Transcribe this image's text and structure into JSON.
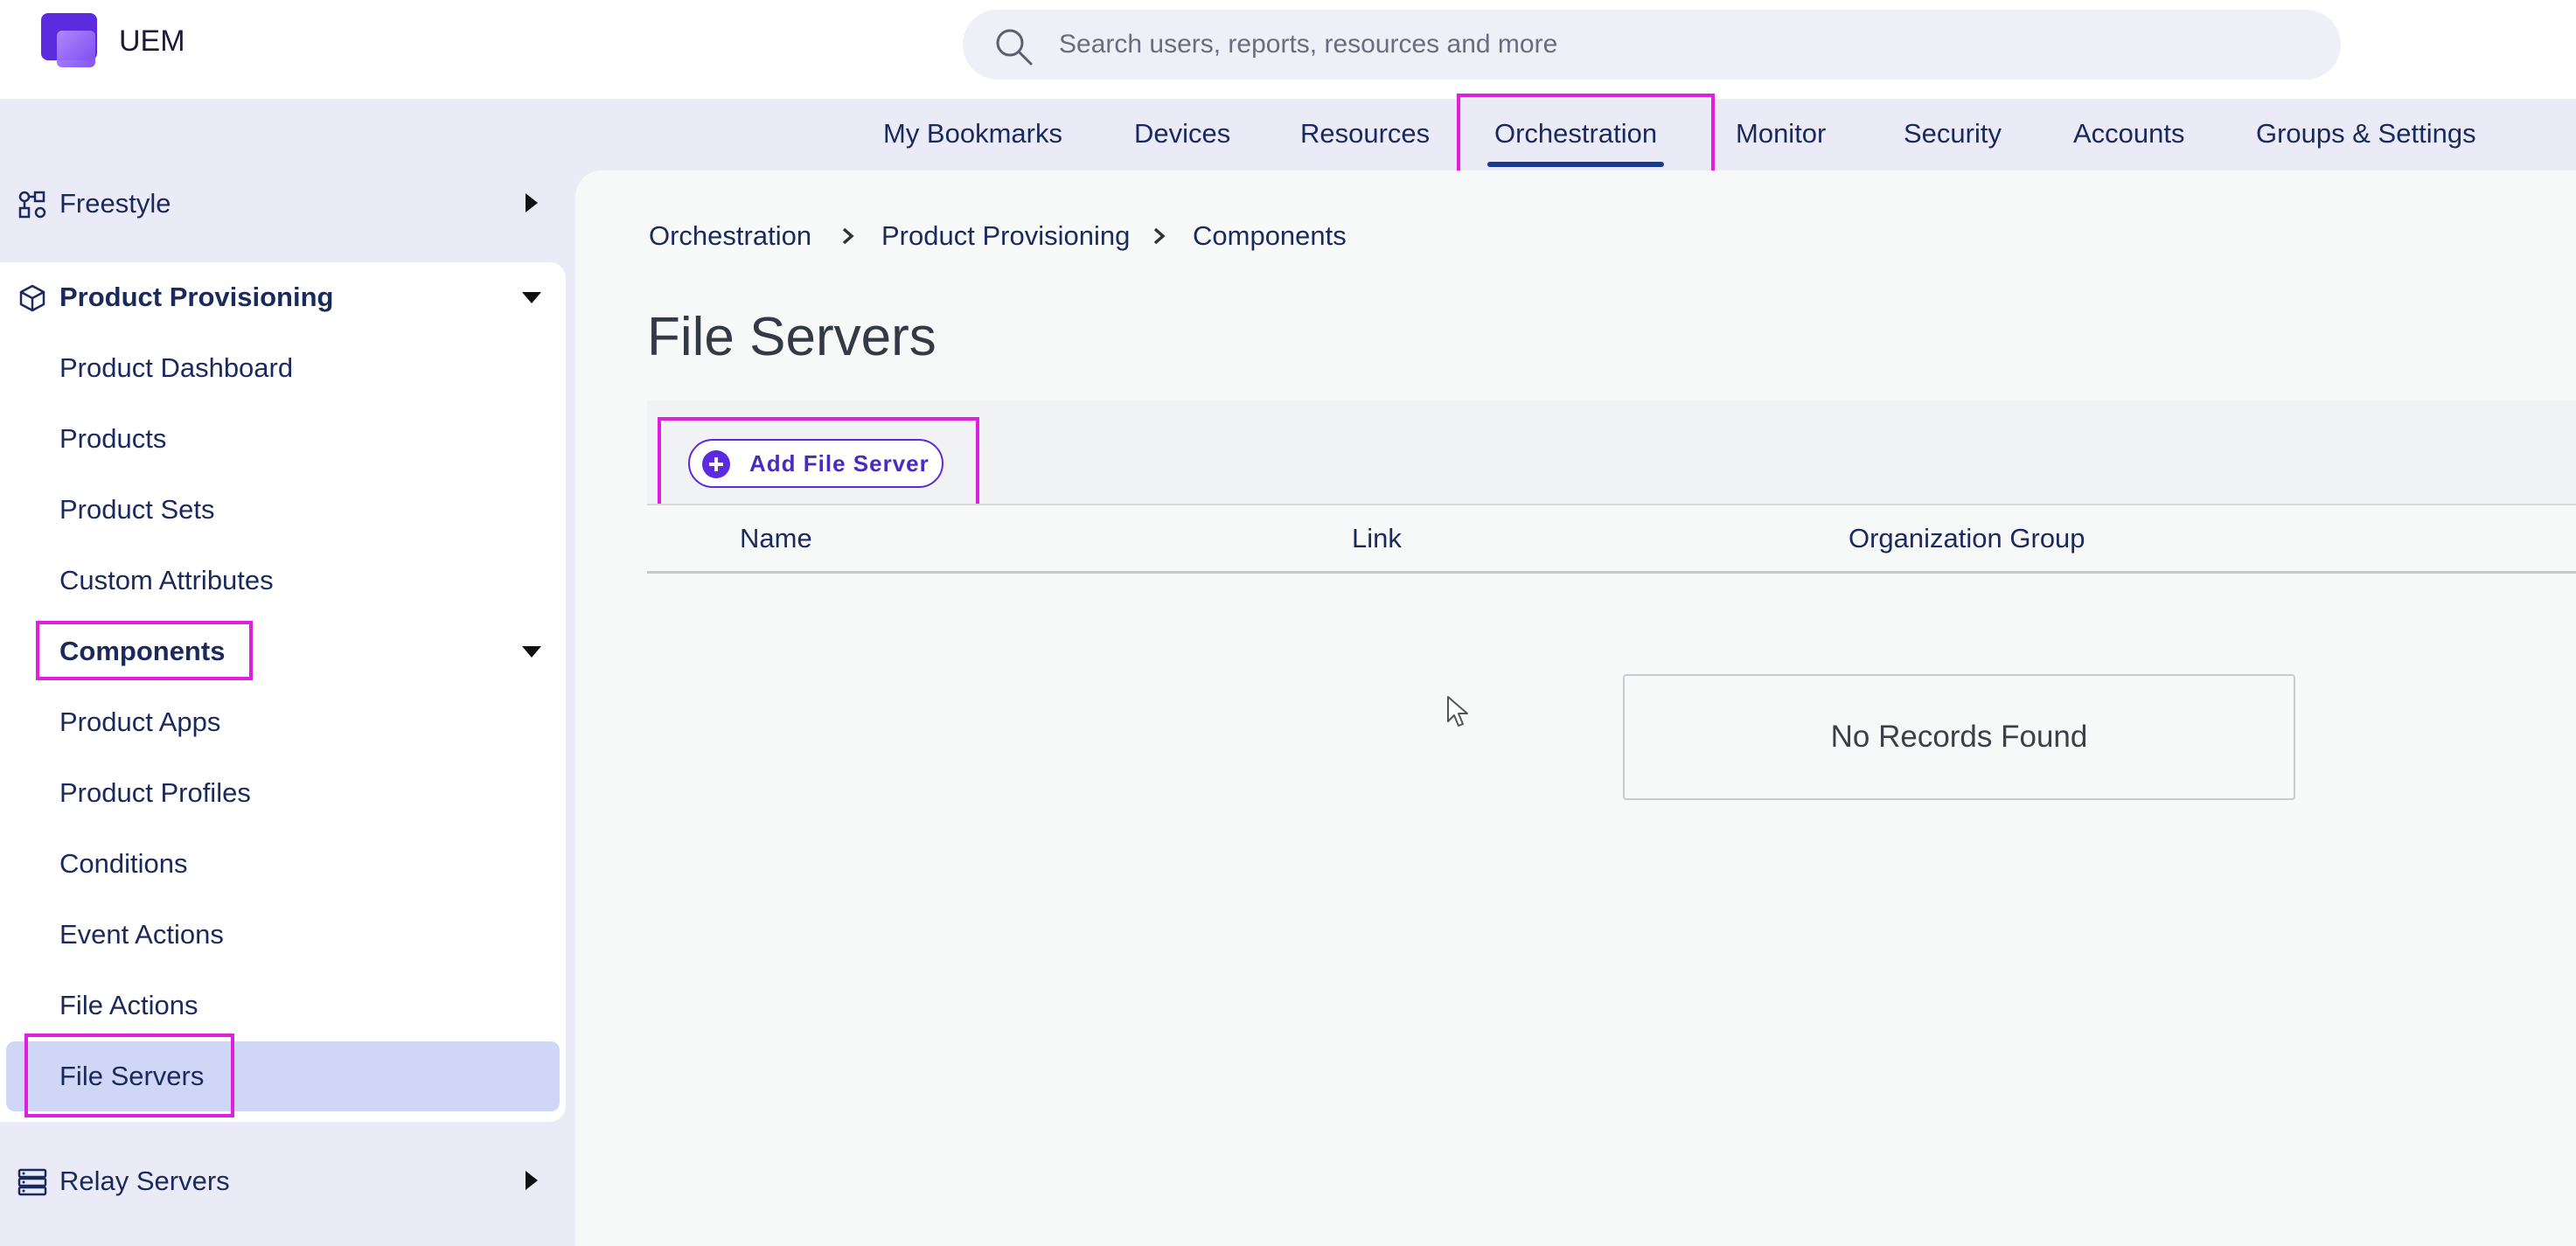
{
  "app": {
    "name": "UEM"
  },
  "search": {
    "placeholder": "Search users, reports, resources and more"
  },
  "nav": {
    "items": [
      {
        "label": "My Bookmarks"
      },
      {
        "label": "Devices"
      },
      {
        "label": "Resources"
      },
      {
        "label": "Orchestration",
        "active": true
      },
      {
        "label": "Monitor"
      },
      {
        "label": "Security"
      },
      {
        "label": "Accounts"
      },
      {
        "label": "Groups & Settings"
      }
    ]
  },
  "sidebar": {
    "freestyle": {
      "label": "Freestyle",
      "icon": "workflow-icon"
    },
    "product_provisioning": {
      "label": "Product Provisioning",
      "icon": "package-icon",
      "items": [
        {
          "label": "Product Dashboard"
        },
        {
          "label": "Products"
        },
        {
          "label": "Product Sets"
        },
        {
          "label": "Custom Attributes"
        }
      ],
      "components": {
        "label": "Components",
        "items": [
          {
            "label": "Product Apps"
          },
          {
            "label": "Product Profiles"
          },
          {
            "label": "Conditions"
          },
          {
            "label": "Event Actions"
          },
          {
            "label": "File Actions"
          },
          {
            "label": "File Servers",
            "selected": true
          }
        ]
      }
    },
    "relay_servers": {
      "label": "Relay Servers",
      "icon": "server-icon"
    }
  },
  "breadcrumb": [
    "Orchestration",
    "Product Provisioning",
    "Components"
  ],
  "page": {
    "title": "File Servers"
  },
  "toolbar": {
    "add_label": "Add File Server"
  },
  "table": {
    "columns": [
      "Name",
      "Link",
      "Organization Group"
    ],
    "rows": [],
    "empty_text": "No Records Found"
  },
  "colors": {
    "accent": "#5b2be0",
    "nav_text": "#1b2a5c",
    "highlight": "#e01ee0",
    "selected_bg": "#cfd6f6"
  }
}
